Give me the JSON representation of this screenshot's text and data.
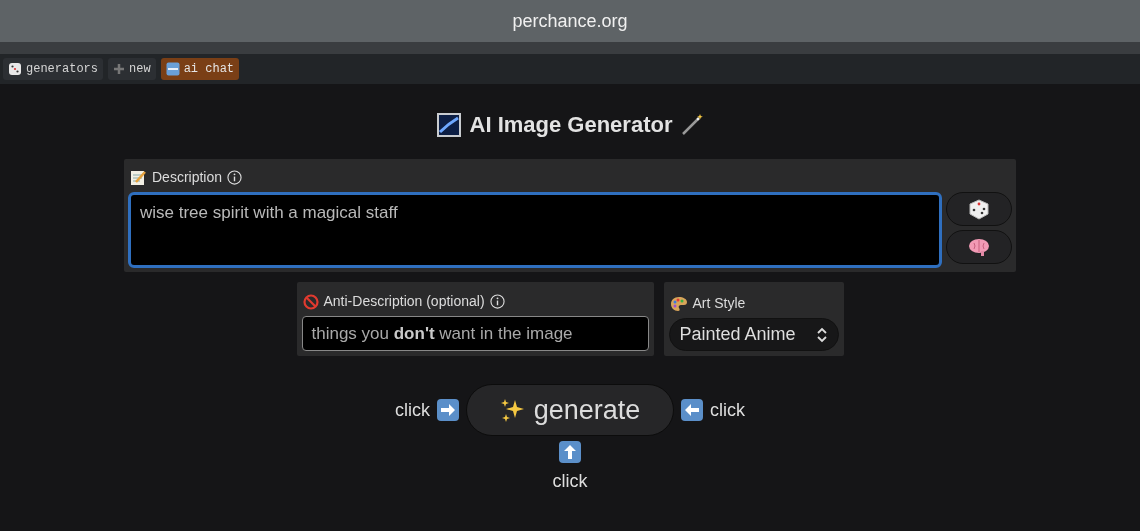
{
  "address_bar": {
    "url": "perchance.org"
  },
  "nav_tabs": [
    {
      "label": "generators",
      "kind": "dice",
      "highlighted": false
    },
    {
      "label": "new",
      "kind": "plus",
      "highlighted": false
    },
    {
      "label": "ai chat",
      "kind": "new",
      "highlighted": true
    }
  ],
  "title": "AI Image Generator",
  "description": {
    "label": "Description",
    "value": "wise tree spirit with a magical staff",
    "focused": true
  },
  "anti_description": {
    "label": "Anti-Description (optional)",
    "placeholder": "things you **don't** want in the image"
  },
  "art_style": {
    "label": "Art Style",
    "value": "Painted Anime"
  },
  "generate": {
    "label": "generate",
    "left_hint": "click",
    "right_hint": "click",
    "bottom_hint": "click"
  }
}
